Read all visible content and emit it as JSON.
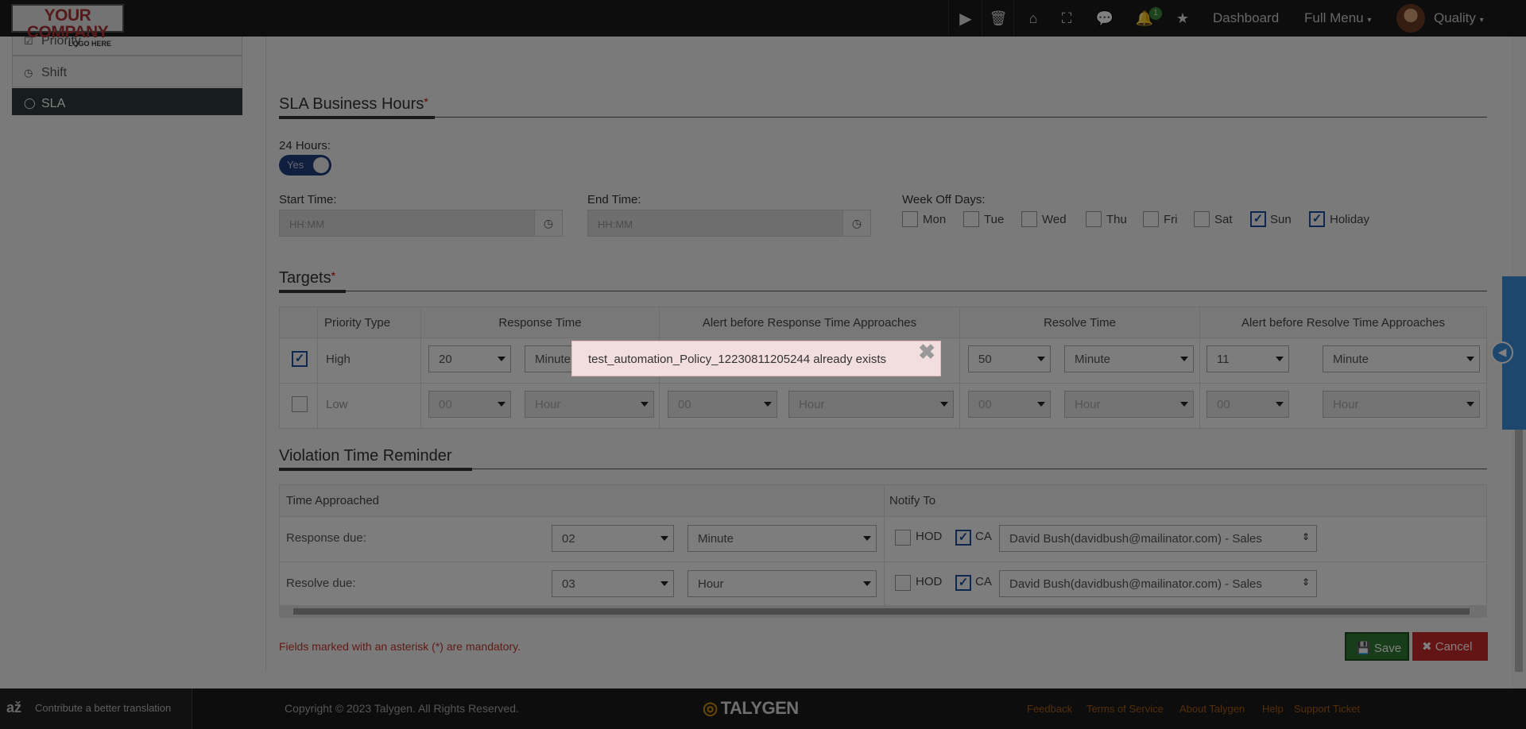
{
  "topbar": {
    "logo_line1": "YOUR COMPANY",
    "logo_line2": "LOGO HERE",
    "notification_count": "1",
    "dashboard": "Dashboard",
    "full_menu": "Full Menu",
    "user": "Quality"
  },
  "sidebar": {
    "items": [
      {
        "label": "Priority"
      },
      {
        "label": "Shift"
      },
      {
        "label": "SLA"
      }
    ]
  },
  "business_hours": {
    "title": "SLA Business Hours",
    "hours24_label": "24 Hours:",
    "toggle_label": "Yes",
    "start_label": "Start Time:",
    "start_placeholder": "HH:MM",
    "end_label": "End Time:",
    "end_placeholder": "HH:MM",
    "weekoff_label": "Week Off Days:",
    "days": [
      {
        "label": "Mon",
        "checked": false
      },
      {
        "label": "Tue",
        "checked": false
      },
      {
        "label": "Wed",
        "checked": false
      },
      {
        "label": "Thu",
        "checked": false
      },
      {
        "label": "Fri",
        "checked": false
      },
      {
        "label": "Sat",
        "checked": false
      },
      {
        "label": "Sun",
        "checked": true
      },
      {
        "label": "Holiday",
        "checked": true
      }
    ]
  },
  "targets": {
    "title": "Targets",
    "headers": [
      "Priority Type",
      "Response Time",
      "Alert before Response Time Approaches",
      "Resolve Time",
      "Alert before Resolve Time Approaches"
    ],
    "rows": [
      {
        "priority": "High",
        "checked": true,
        "values": [
          "20",
          "Minute",
          "",
          "",
          "50",
          "Minute",
          "11",
          "Minute"
        ]
      },
      {
        "priority": "Low",
        "checked": false,
        "values": [
          "00",
          "Hour",
          "00",
          "Hour",
          "00",
          "Hour",
          "00",
          "Hour"
        ]
      }
    ]
  },
  "violation": {
    "title": "Violation Time Reminder",
    "col1": "Time Approached",
    "col2": "Notify To",
    "rows": [
      {
        "label": "Response due:",
        "value": "02",
        "unit": "Minute",
        "hod": "HOD",
        "ca": "CA",
        "person": "David Bush(davidbush@mailinator.com) - Sales"
      },
      {
        "label": "Resolve due:",
        "value": "03",
        "unit": "Hour",
        "hod": "HOD",
        "ca": "CA",
        "person": "David Bush(davidbush@mailinator.com) - Sales"
      }
    ]
  },
  "form": {
    "mandatory_note": "Fields marked with an asterisk (*) are mandatory.",
    "save": "Save",
    "cancel": "Cancel"
  },
  "toast": {
    "message": "test_automation_Policy_12230811205244 already exists"
  },
  "footer": {
    "translate": "Contribute a better translation",
    "copyright": "Copyright © 2023 Talygen. All Rights Reserved.",
    "brand": "TALYGEN",
    "links": [
      "Feedback",
      "Terms of Service",
      "About Talygen",
      "Help",
      "Support Ticket"
    ]
  },
  "colors": {
    "toast_bg": "#f2dede",
    "save": "#2e7d32",
    "cancel": "#c62828",
    "accent": "#1f3f7a"
  }
}
